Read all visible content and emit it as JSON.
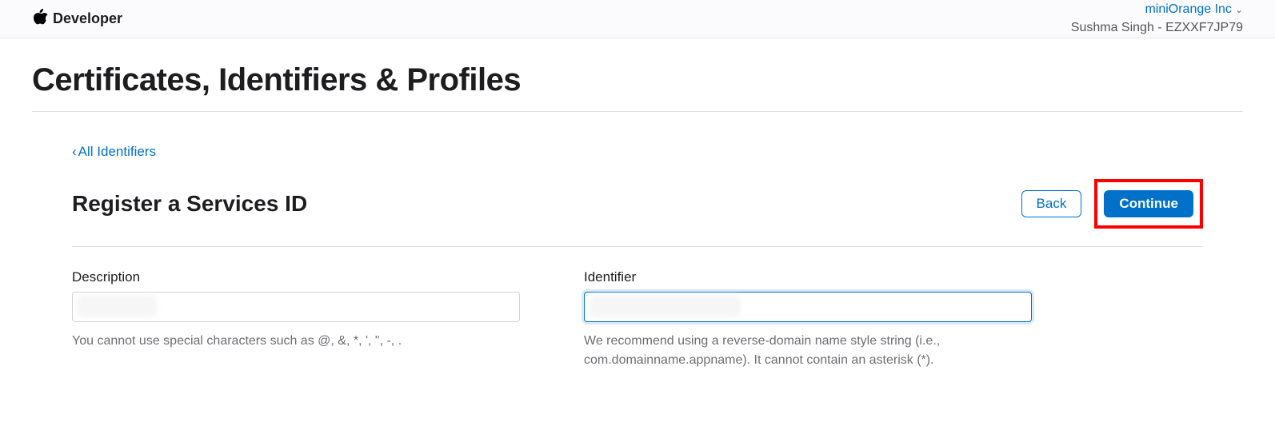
{
  "header": {
    "brand": "Developer",
    "org": "miniOrange Inc",
    "user": "Sushma Singh - EZXXF7JP79"
  },
  "page": {
    "title": "Certificates, Identifiers & Profiles",
    "back_link": "All Identifiers",
    "sub_title": "Register a Services ID",
    "back_button": "Back",
    "continue_button": "Continue"
  },
  "form": {
    "description_label": "Description",
    "description_helper": "You cannot use special characters such as @, &, *, ', \", -, .",
    "identifier_label": "Identifier",
    "identifier_helper": "We recommend using a reverse-domain name style string (i.e., com.domainname.appname). It cannot contain an asterisk (*)."
  }
}
